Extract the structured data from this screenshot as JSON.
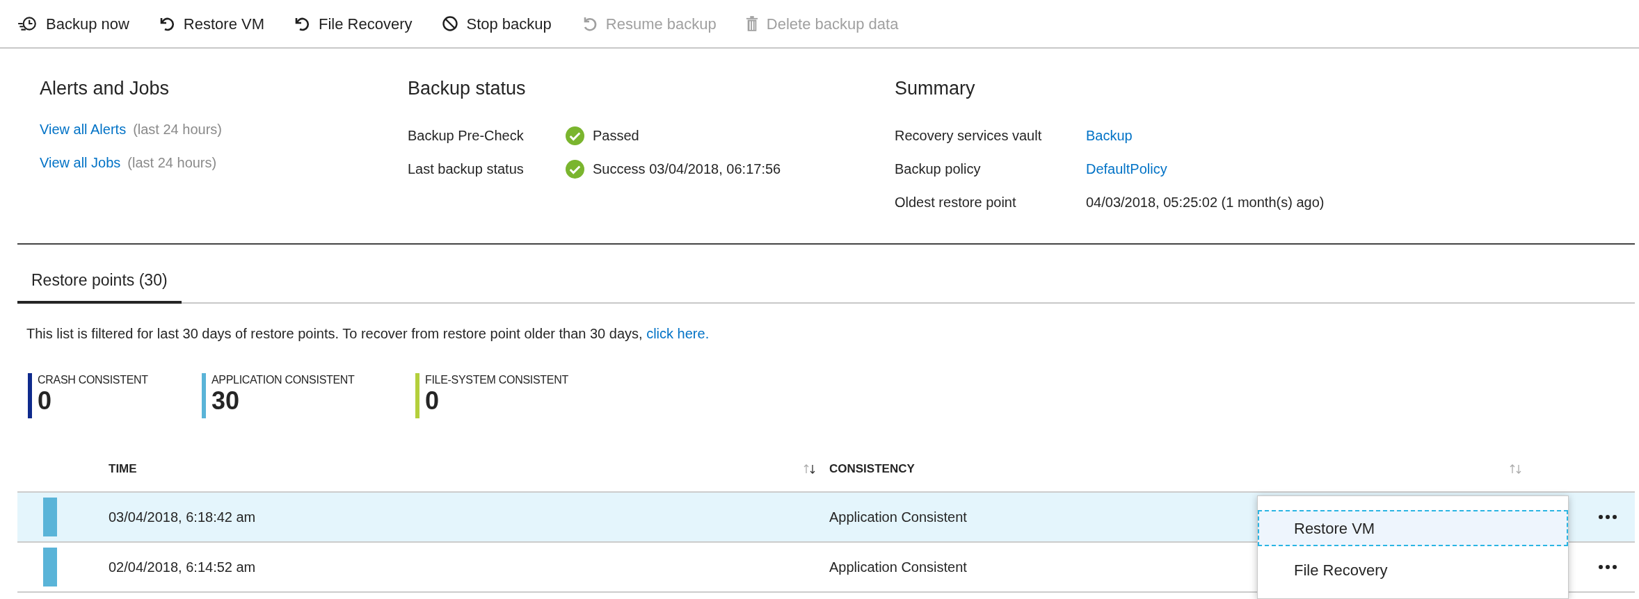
{
  "toolbar": [
    {
      "label": "Backup now",
      "disabled": false
    },
    {
      "label": "Restore VM",
      "disabled": false
    },
    {
      "label": "File Recovery",
      "disabled": false
    },
    {
      "label": "Stop backup",
      "disabled": false
    },
    {
      "label": "Resume backup",
      "disabled": true
    },
    {
      "label": "Delete backup data",
      "disabled": true
    }
  ],
  "alerts_and_jobs": {
    "title": "Alerts and Jobs",
    "links": [
      {
        "link": "View all Alerts",
        "note": "(last 24 hours)"
      },
      {
        "link": "View all Jobs",
        "note": "(last 24 hours)"
      }
    ]
  },
  "backup_status": {
    "title": "Backup status",
    "rows": [
      {
        "label": "Backup Pre-Check",
        "value": "Passed",
        "ok": true
      },
      {
        "label": "Last backup status",
        "value": "Success 03/04/2018, 06:17:56",
        "ok": true
      }
    ]
  },
  "summary": {
    "title": "Summary",
    "rows": [
      {
        "label": "Recovery services vault",
        "value": "Backup",
        "kind": "link"
      },
      {
        "label": "Backup policy",
        "value": "DefaultPolicy",
        "kind": "link"
      },
      {
        "label": "Oldest restore point",
        "value": "04/03/2018, 05:25:02 (1 month(s) ago)",
        "kind": "text"
      }
    ]
  },
  "tabs": [
    {
      "label": "Restore points (30)",
      "selected": true
    }
  ],
  "filter_note": {
    "text": "This list is filtered for last 30 days of restore points. To recover from restore point older than 30 days,",
    "link": "click here."
  },
  "legend": [
    {
      "label": "CRASH CONSISTENT",
      "count": "0",
      "color": "#0f2a8c"
    },
    {
      "label": "APPLICATION CONSISTENT",
      "count": "30",
      "color": "#5ab4d8"
    },
    {
      "label": "FILE-SYSTEM CONSISTENT",
      "count": "0",
      "color": "#b4cf3c"
    }
  ],
  "table": {
    "columns": [
      "TIME",
      "CONSISTENCY"
    ],
    "rows": [
      {
        "time": "03/04/2018, 6:18:42 am",
        "consistency": "Application Consistent",
        "color": "#5ab4d8",
        "selected": true
      },
      {
        "time": "02/04/2018, 6:14:52 am",
        "consistency": "Application Consistent",
        "color": "#5ab4d8",
        "selected": false
      }
    ]
  },
  "context_menu": {
    "items": [
      {
        "label": "Restore VM",
        "selected": true
      },
      {
        "label": "File Recovery",
        "selected": false
      }
    ]
  }
}
